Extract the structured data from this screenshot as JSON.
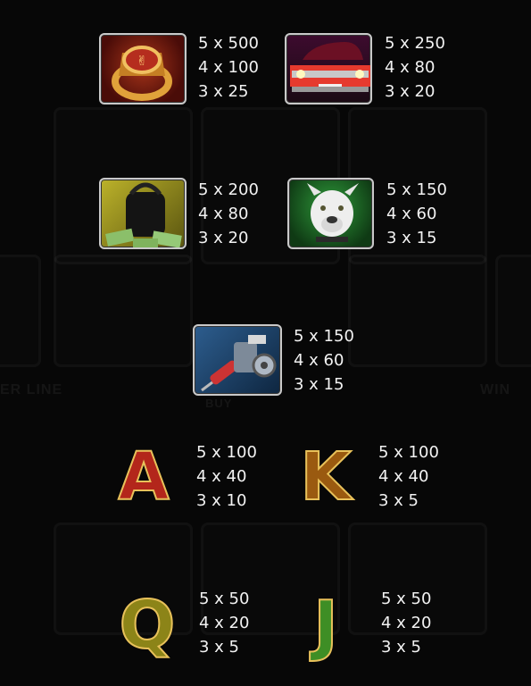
{
  "background": {
    "labels": [
      "ER LINE",
      "BUY",
      "WIN"
    ],
    "reel_color": "#121212"
  },
  "symbols": [
    {
      "name": "gold-ring",
      "icon": "ring-icon",
      "pays": [
        "5 x 500",
        "4 x 100",
        "3 x 25"
      ]
    },
    {
      "name": "red-car",
      "icon": "car-icon",
      "pays": [
        "5 x 250",
        "4 x 80",
        "3 x 20"
      ]
    },
    {
      "name": "money-bag",
      "icon": "money-bag-icon",
      "pays": [
        "5 x 200",
        "4 x 80",
        "3 x 20"
      ]
    },
    {
      "name": "pitbull",
      "icon": "dog-icon",
      "pays": [
        "5 x 150",
        "4 x 60",
        "3 x 15"
      ]
    },
    {
      "name": "tattoo-machine",
      "icon": "tattoo-gun-icon",
      "pays": [
        "5 x 150",
        "4 x 60",
        "3 x 15"
      ]
    },
    {
      "name": "letter-a",
      "label": "A",
      "pays": [
        "5 x 100",
        "4 x 40",
        "3 x 10"
      ]
    },
    {
      "name": "letter-k",
      "label": "K",
      "pays": [
        "5 x 100",
        "4 x 40",
        "3 x 5"
      ]
    },
    {
      "name": "letter-q",
      "label": "Q",
      "pays": [
        "5 x 50",
        "4 x 20",
        "3 x 5"
      ]
    },
    {
      "name": "letter-j",
      "label": "J",
      "pays": [
        "5 x 50",
        "4 x 20",
        "3 x 5"
      ]
    }
  ]
}
